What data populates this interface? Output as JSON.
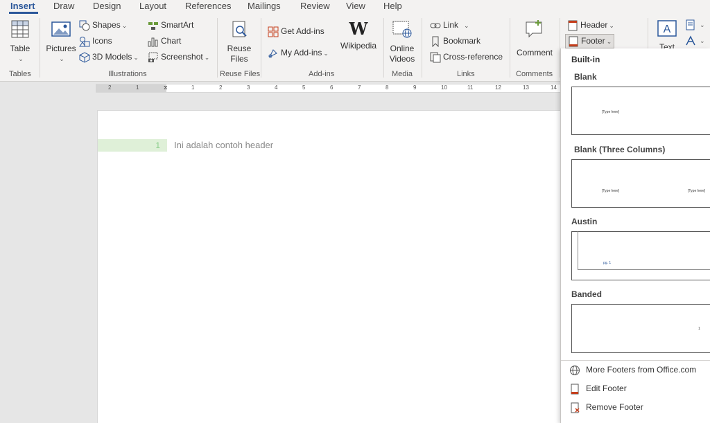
{
  "tabs": [
    "Insert",
    "Draw",
    "Design",
    "Layout",
    "References",
    "Mailings",
    "Review",
    "View",
    "Help"
  ],
  "ribbon": {
    "tables": {
      "table": "Table",
      "group": "Tables"
    },
    "illustrations": {
      "pictures": "Pictures",
      "shapes": "Shapes",
      "icons": "Icons",
      "models": "3D Models",
      "smartart": "SmartArt",
      "chart": "Chart",
      "screenshot": "Screenshot",
      "group": "Illustrations"
    },
    "reuse": {
      "line1": "Reuse",
      "line2": "Files",
      "group": "Reuse Files"
    },
    "addins": {
      "get": "Get Add-ins",
      "my": "My Add-ins",
      "wikipedia": "Wikipedia",
      "group": "Add-ins"
    },
    "media": {
      "line1": "Online",
      "line2": "Videos",
      "group": "Media"
    },
    "links": {
      "link": "Link",
      "bookmark": "Bookmark",
      "crossref": "Cross-reference",
      "group": "Links"
    },
    "comments": {
      "comment": "Comment",
      "group": "Comments"
    },
    "headerfooter": {
      "header": "Header",
      "footer": "Footer"
    },
    "text": {
      "textbox_partial": "Text"
    }
  },
  "ruler": {
    "labels": [
      "2",
      "1",
      "",
      "1",
      "2",
      "3",
      "4",
      "5",
      "6",
      "7",
      "8",
      "9",
      "10",
      "11",
      "12",
      "13",
      "14"
    ]
  },
  "document": {
    "line_number": "1",
    "header_text": "Ini adalah contoh header"
  },
  "gallery": {
    "section": "Built-in",
    "items": [
      {
        "title": "Blank",
        "thumb_left": "[Type here]",
        "thumb_right": ""
      },
      {
        "title": "Blank (Three Columns)",
        "thumb_left": "[Type here]",
        "thumb_right": "[Type here]"
      },
      {
        "title": "Austin",
        "thumb_left": "pg. 1",
        "thumb_right": ""
      },
      {
        "title": "Banded",
        "thumb_left": "",
        "thumb_right": "1"
      }
    ],
    "more": "More Footers from Office.com",
    "edit": "Edit Footer",
    "remove": "Remove Footer"
  },
  "colors": {
    "accent": "#2b579a",
    "ribbon_bg": "#f3f2f1",
    "line_highlight": "#dff0d8"
  }
}
